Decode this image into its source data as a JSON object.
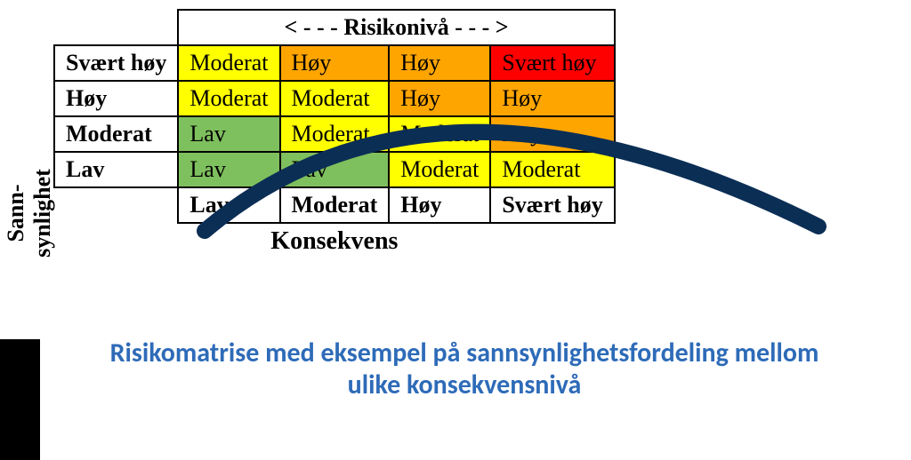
{
  "header": {
    "risk_level": "<  - - -  Risikonivå - - -  >"
  },
  "axes": {
    "y_label": "Sann-\nsynlighet",
    "x_label": "Konsekvens",
    "rows": [
      "Svært høy",
      "Høy",
      "Moderat",
      "Lav"
    ],
    "cols": [
      "Lav",
      "Moderat",
      "Høy",
      "Svært høy"
    ]
  },
  "cells": {
    "r0": [
      "Moderat",
      "Høy",
      "Høy",
      "Svært høy"
    ],
    "r1": [
      "Moderat",
      "Moderat",
      "Høy",
      "Høy"
    ],
    "r2": [
      "Lav",
      "Moderat",
      "Moderat",
      "Høy"
    ],
    "r3": [
      "Lav",
      "Lav",
      "Moderat",
      "Moderat"
    ]
  },
  "caption": "Risikomatrise med eksempel på sannsynlighetsfordeling mellom\nulike konsekvensnivå",
  "chart_data": {
    "type": "table",
    "title": "Risikomatrise",
    "x_axis": "Konsekvens",
    "y_axis": "Sannsynlighet",
    "x_categories": [
      "Lav",
      "Moderat",
      "Høy",
      "Svært høy"
    ],
    "y_categories": [
      "Svært høy",
      "Høy",
      "Moderat",
      "Lav"
    ],
    "matrix": [
      [
        "Moderat",
        "Høy",
        "Høy",
        "Svært høy"
      ],
      [
        "Moderat",
        "Moderat",
        "Høy",
        "Høy"
      ],
      [
        "Lav",
        "Moderat",
        "Moderat",
        "Høy"
      ],
      [
        "Lav",
        "Lav",
        "Moderat",
        "Moderat"
      ]
    ],
    "color_legend": {
      "Lav": "#7fc05e",
      "Moderat": "#ffff00",
      "Høy": "#ffa500",
      "Svært høy": "#ff0000"
    },
    "overlay_curve": {
      "description": "sannsynlighetsfordeling over konsekvensnivå",
      "approx_points": [
        {
          "x": "Lav",
          "y": "Lav"
        },
        {
          "x": "Moderat",
          "y": "Høy"
        },
        {
          "x": "Høy",
          "y": "Moderat"
        },
        {
          "x": "Svært høy",
          "y": "Lav"
        }
      ]
    }
  }
}
